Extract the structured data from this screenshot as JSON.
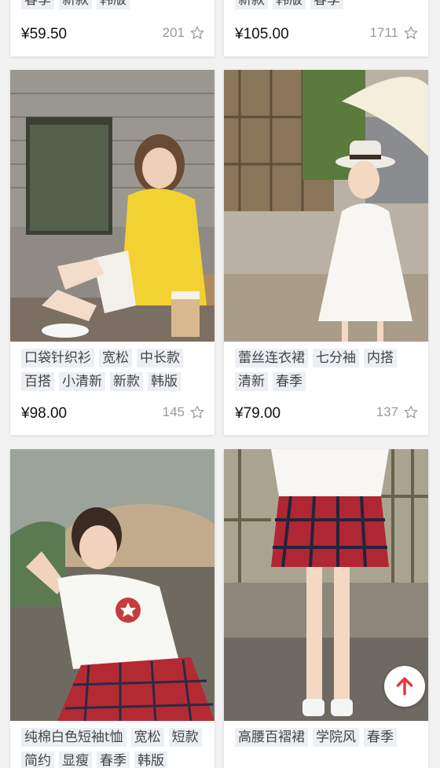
{
  "products": [
    {
      "tags": [
        "春季",
        "新款",
        "韩版"
      ],
      "price": "¥59.50",
      "likes": "201",
      "image": "partial-top-item-left"
    },
    {
      "tags": [
        "新款",
        "韩版",
        "春季"
      ],
      "price": "¥105.00",
      "likes": "1711",
      "image": "partial-top-item-right"
    },
    {
      "tags": [
        "口袋针织衫",
        "宽松",
        "中长款",
        "百搭",
        "小清新",
        "新款",
        "韩版"
      ],
      "price": "¥98.00",
      "likes": "145",
      "image": "woman-yellow-cardigan-sitting-photo"
    },
    {
      "tags": [
        "蕾丝连衣裙",
        "七分袖",
        "内搭",
        "清新",
        "春季"
      ],
      "price": "¥79.00",
      "likes": "137",
      "image": "woman-white-lace-dress-hat-photo"
    },
    {
      "tags": [
        "纯棉白色短袖t恤",
        "宽松",
        "短款",
        "简约",
        "显瘦",
        "春季",
        "韩版"
      ],
      "image": "woman-white-tshirt-plaid-skirt-photo"
    },
    {
      "tags": [
        "高腰百褶裙",
        "学院风",
        "春季"
      ],
      "image": "red-plaid-pleated-skirt-photo"
    }
  ],
  "icons": {
    "like": "star-outline-icon",
    "back_to_top": "arrow-up-icon"
  },
  "colors": {
    "accent": "#e8353d",
    "tag_bg": "#eceff3",
    "like_text": "#9a9a9a"
  }
}
